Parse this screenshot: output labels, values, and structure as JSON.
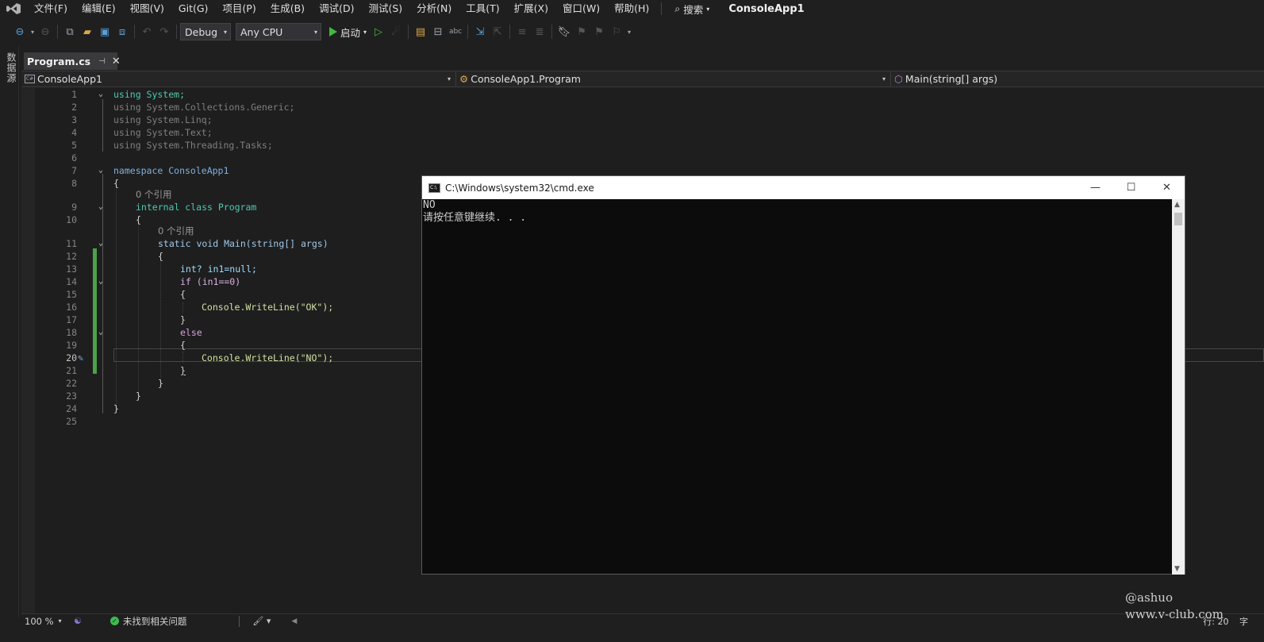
{
  "menu": {
    "items": [
      "文件(F)",
      "编辑(E)",
      "视图(V)",
      "Git(G)",
      "项目(P)",
      "生成(B)",
      "调试(D)",
      "测试(S)",
      "分析(N)",
      "工具(T)",
      "扩展(X)",
      "窗口(W)",
      "帮助(H)"
    ],
    "search_label": "搜索",
    "solution_name": "ConsoleApp1"
  },
  "toolbar": {
    "configuration": "Debug",
    "platform": "Any CPU",
    "run_label": "启动"
  },
  "left_strip": {
    "label": "数据源"
  },
  "document_tab": {
    "label": "Program.cs"
  },
  "navigation": {
    "project": "ConsoleApp1",
    "type": "ConsoleApp1.Program",
    "member": "Main(string[] args)"
  },
  "editor": {
    "current_line": "20",
    "lines": [
      {
        "n": "1",
        "text": "using System;"
      },
      {
        "n": "2",
        "text": "using System.Collections.Generic;"
      },
      {
        "n": "3",
        "text": "using System.Linq;"
      },
      {
        "n": "4",
        "text": "using System.Text;"
      },
      {
        "n": "5",
        "text": "using System.Threading.Tasks;"
      },
      {
        "n": "6",
        "text": ""
      },
      {
        "n": "7",
        "text": "namespace ConsoleApp1"
      },
      {
        "n": "8",
        "text": "{"
      },
      {
        "n": "",
        "text": "0 个引用"
      },
      {
        "n": "9",
        "text": "internal class Program"
      },
      {
        "n": "10",
        "text": "{"
      },
      {
        "n": "",
        "text": "0 个引用"
      },
      {
        "n": "11",
        "text": "static void Main(string[] args)"
      },
      {
        "n": "12",
        "text": "{"
      },
      {
        "n": "13",
        "text": "int? in1=null;"
      },
      {
        "n": "14",
        "text": "if (in1==0)"
      },
      {
        "n": "15",
        "text": "{"
      },
      {
        "n": "16",
        "text": "Console.WriteLine(\"OK\");"
      },
      {
        "n": "17",
        "text": "}"
      },
      {
        "n": "18",
        "text": "else"
      },
      {
        "n": "19",
        "text": "{"
      },
      {
        "n": "20",
        "text": "Console.WriteLine(\"NO\");"
      },
      {
        "n": "21",
        "text": "}"
      },
      {
        "n": "22",
        "text": "}"
      },
      {
        "n": "23",
        "text": "}"
      },
      {
        "n": "24",
        "text": "}"
      },
      {
        "n": "25",
        "text": ""
      }
    ]
  },
  "status": {
    "zoom": "100 %",
    "issues": "未找到相关问题",
    "line_info": "行: 20",
    "char_label": "字"
  },
  "console": {
    "title": "C:\\Windows\\system32\\cmd.exe",
    "output_line1": "NO",
    "output_line2": "请按任意键继续. . ."
  },
  "watermark": {
    "line1": "@ashuo",
    "line2": "www.v-club.com"
  },
  "colors": {
    "background": "#1f1f1f",
    "editor_background": "#1e1e1e",
    "keyword": "#569cd6",
    "type": "#4ec9b0",
    "method": "#dcdcaa",
    "string": "#d69d85",
    "control_keyword": "#d8a0df",
    "change_bar": "#4aa24a",
    "console_background": "#0c0c0c",
    "run_green": "#3fb93f"
  },
  "icons": [
    "vs-logo-icon",
    "search-icon",
    "back-icon",
    "forward-icon",
    "new-project-icon",
    "open-icon",
    "save-icon",
    "save-all-icon",
    "undo-icon",
    "redo-icon",
    "start-icon",
    "start-without-debug-icon",
    "bookmark-icon",
    "pin-icon",
    "close-icon",
    "csharp-project-icon",
    "class-icon",
    "method-icon",
    "check-icon",
    "brush-icon",
    "console-icon",
    "minimize-icon",
    "maximize-icon"
  ]
}
